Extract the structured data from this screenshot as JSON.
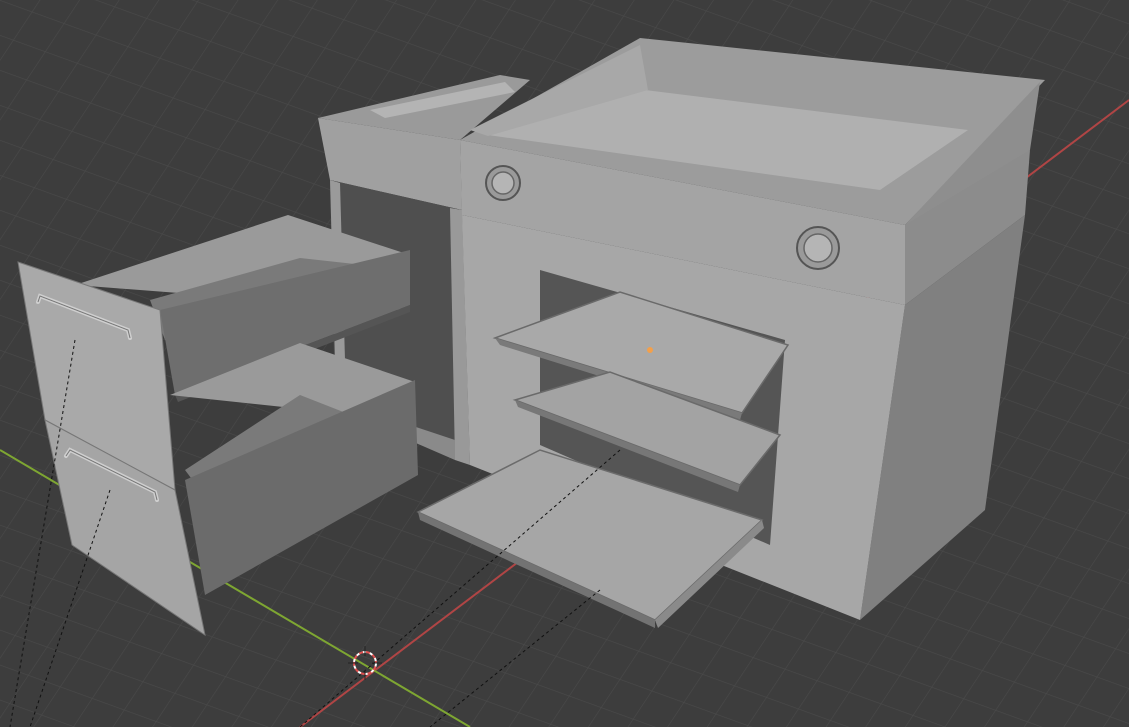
{
  "app": {
    "view": "3D Viewport",
    "shading": "solid"
  },
  "scene": {
    "objects": [
      "drawer-unit",
      "cabinet",
      "griddle-oven"
    ]
  },
  "colors": {
    "background": "#3d3d3d",
    "grid": "#4a4a4a",
    "x_axis": "#b04545",
    "y_axis": "#7ea632",
    "model_light": "#a8a8a8",
    "model_mid": "#8c8c8c",
    "model_dark": "#5a5a5a",
    "origin": "#f3a04b"
  }
}
